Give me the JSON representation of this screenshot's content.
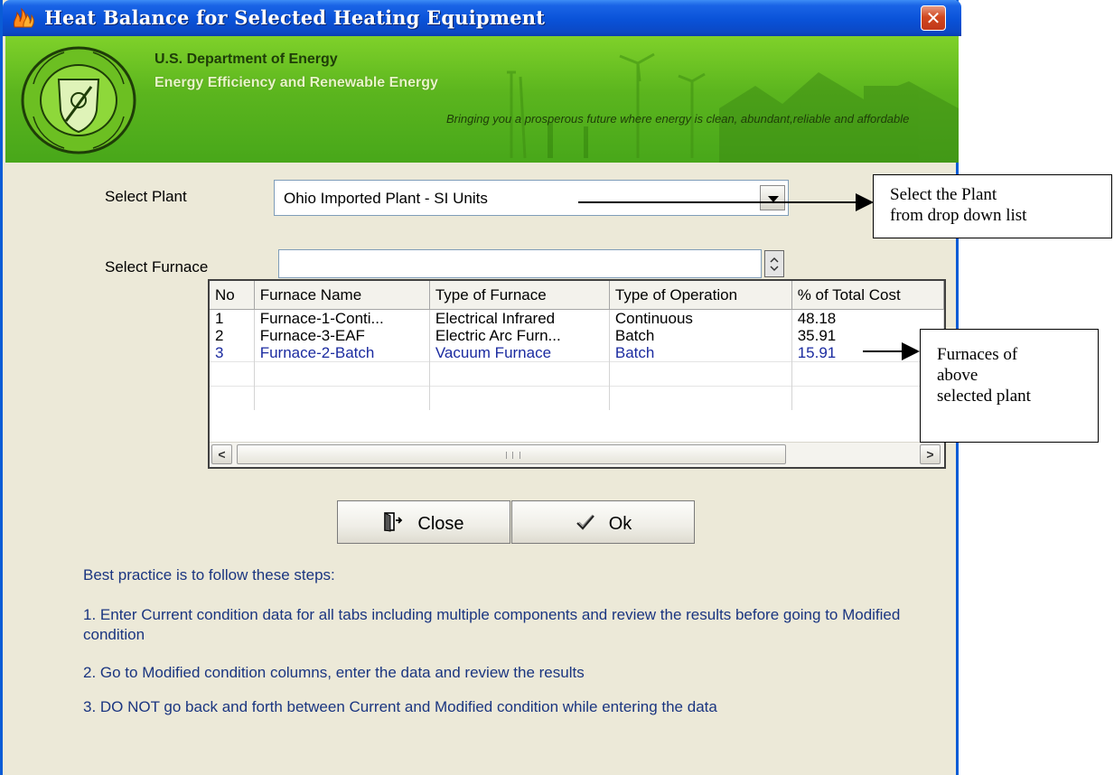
{
  "window": {
    "title": "Heat Balance for Selected Heating Equipment",
    "close_glyph": "✕"
  },
  "banner": {
    "agency_line1": "U.S. Department of Energy",
    "agency_line2": "Energy Efficiency and Renewable Energy",
    "tagline": "Bringing you a prosperous future where energy is clean, abundant,reliable and affordable"
  },
  "form": {
    "plant_label": "Select Plant",
    "plant_value": "Ohio Imported Plant - SI Units",
    "furnace_label": "Select Furnace",
    "furnace_value": ""
  },
  "grid": {
    "columns": [
      "No",
      "Furnace Name",
      "Type of Furnace",
      "Type of Operation",
      "% of Total Cost"
    ],
    "rows": [
      [
        "1",
        "Furnace-1-Conti...",
        "Electrical Infrared",
        "Continuous",
        "48.18"
      ],
      [
        "2",
        "Furnace-3-EAF",
        "Electric Arc Furn...",
        "Batch",
        "35.91"
      ],
      [
        "3",
        "Furnace-2-Batch",
        "Vacuum Furnace",
        "Batch",
        "15.91"
      ]
    ],
    "scroll_left": "<",
    "scroll_right": ">"
  },
  "buttons": {
    "close_label": "Close",
    "ok_label": "Ok"
  },
  "instructions": {
    "heading": "Best practice is to follow these steps:",
    "step1": "1. Enter Current condition data for all tabs including multiple components and review the results before going to Modified condition",
    "step2": "2. Go to Modified condition columns, enter the data and review the results",
    "step3": "3. DO NOT go back and forth between Current and Modified condition while entering the data"
  },
  "annotations": {
    "plant_note_line1": "Select the Plant",
    "plant_note_line2": "from drop down list",
    "furnace_note_line1": "Furnaces of",
    "furnace_note_line2": "above",
    "furnace_note_line3": "selected plant"
  },
  "colors": {
    "titlebar": "#0a52d8",
    "banner_green": "#5bb51e",
    "instruction_text": "#1a3580",
    "dialog_bg": "#ece9d8"
  }
}
